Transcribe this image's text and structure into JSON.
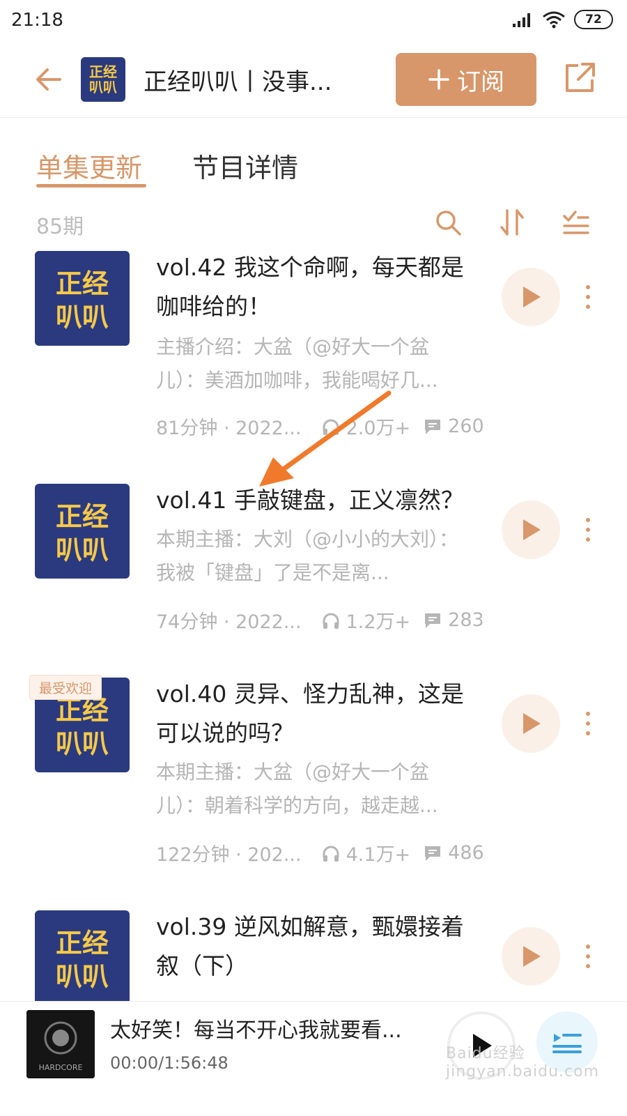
{
  "status": {
    "time": "21:18",
    "battery": "72"
  },
  "header": {
    "title": "正经叭叭丨没事...",
    "subscribe_label": "订阅",
    "logo_text_top": "正经",
    "logo_text_bottom": "叭叭"
  },
  "tabs": [
    {
      "label": "单集更新",
      "active": true
    },
    {
      "label": "节目详情",
      "active": false
    }
  ],
  "list": {
    "count": "85期"
  },
  "episodes": [
    {
      "title": "vol.42 我这个命啊，每天都是咖啡给的！",
      "desc": "主播介绍：大盆（@好大一个盆儿）：美酒加咖啡，我能喝好几...",
      "duration_date": "81分钟 · 2022...",
      "plays": "2.0万+",
      "comments": "260"
    },
    {
      "title": "vol.41 手敲键盘，正义凛然？",
      "desc": "本期主播：大刘（@小小的大刘）：我被「键盘」了是不是离...",
      "duration_date": "74分钟 · 2022...",
      "plays": "1.2万+",
      "comments": "283"
    },
    {
      "badge": "最受欢迎",
      "title": "vol.40 灵异、怪力乱神，这是可以说的吗？",
      "desc": "本期主播：大盆（@好大一个盆儿）：朝着科学的方向，越走越...",
      "duration_date": "122分钟 · 202...",
      "plays": "4.1万+",
      "comments": "486"
    },
    {
      "title": "vol.39 逆风如解意，甄嬛接着叙（下）"
    }
  ],
  "mini_player": {
    "title": "太好笑！每当不开心我就要看...",
    "time": "00:00/1:56:48",
    "cover_text": "HARDCORE"
  },
  "watermark": "Baidu经验 jingyan.baidu.com",
  "colors": {
    "accent": "#d8976a",
    "cover_bg": "#2b3a7e",
    "cover_text": "#f7c948"
  }
}
